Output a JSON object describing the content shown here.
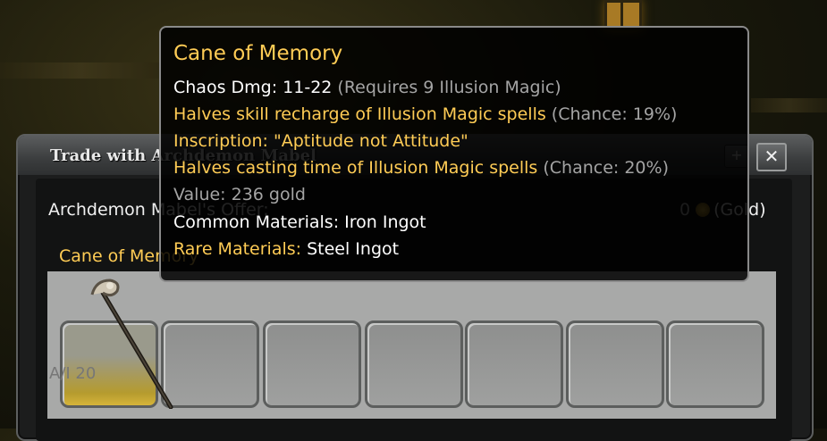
{
  "trade": {
    "title": "Trade with Archdemon Mabel",
    "dock_icon": "+",
    "close_icon": "✕",
    "offer_label": "Archdemon Mabel's Offer:",
    "gold_amount": "0",
    "gold_label": "(Gold)",
    "item_title": "Cane of Memory",
    "slot_count": "A/I 20",
    "slots": 7
  },
  "tooltip": {
    "name": "Cane of Memory",
    "damage_label": "Chaos Dmg: 11-22",
    "damage_req": "(Requires 9 Illusion Magic)",
    "mod1": "Halves skill recharge of Illusion Magic spells",
    "mod1_chance": "(Chance: 19%)",
    "inscription": "Inscription: \"Aptitude not Attitude\"",
    "mod2": "Halves casting time of Illusion Magic spells",
    "mod2_chance": "(Chance: 20%)",
    "value": "Value: 236 gold",
    "common_label": "Common Materials: Iron Ingot",
    "rare_label": "Rare Materials:",
    "rare_value": "Steel Ingot"
  },
  "colors": {
    "item_gold": "#ffcc55",
    "text_white": "#ffffff",
    "text_grey": "#a4a4a4"
  }
}
